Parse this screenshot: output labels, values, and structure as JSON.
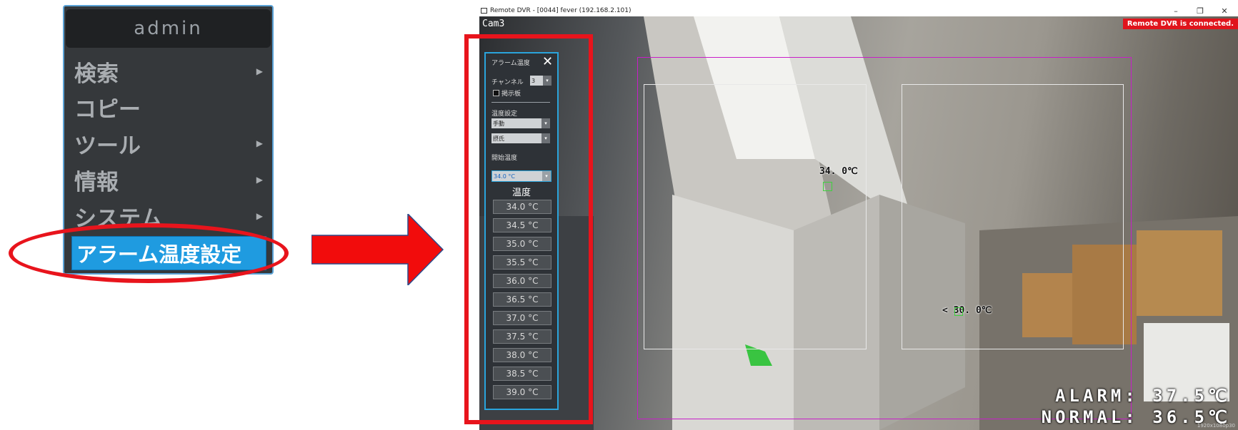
{
  "menu": {
    "title": "admin",
    "items": [
      {
        "label": "検索",
        "has_submenu": true
      },
      {
        "label": "コピー",
        "has_submenu": false
      },
      {
        "label": "ツール",
        "has_submenu": true
      },
      {
        "label": "情報",
        "has_submenu": true
      },
      {
        "label": "システム",
        "has_submenu": true
      }
    ],
    "selected_item": "アラーム温度設定",
    "selected_color": "#1f9be0"
  },
  "annotation": {
    "color": "#e8141c"
  },
  "window": {
    "title": "Remote DVR - [0044] fever (192.168.2.101)",
    "minimize": "–",
    "restore": "❐",
    "close": "✕"
  },
  "camera": {
    "label": "Cam3",
    "status": "Remote DVR is connected.",
    "resolution": "1920x1080p30",
    "alarm_readout": "ALARM: 37.5℃",
    "normal_readout": "NORMAL: 36.5℃",
    "tags": {
      "upper": "34. 0℃",
      "lower": "< 30. 0℃"
    }
  },
  "panel": {
    "title": "アラーム温度",
    "close": "✕",
    "channel_label": "チャンネル",
    "channel_value": "3",
    "board_label": "掲示板",
    "temp_setting_label": "温度設定",
    "mode_value": "手動",
    "unit_value": "摂氏",
    "start_temp_label": "開始温度",
    "start_temp_value": "34.0 °C",
    "dropdown_glyph": "▾",
    "temp_heading": "温度",
    "temps": [
      "34.0 °C",
      "34.5 °C",
      "35.0 °C",
      "35.5 °C",
      "36.0 °C",
      "36.5 °C",
      "37.0 °C",
      "37.5 °C",
      "38.0 °C",
      "38.5 °C",
      "39.0 °C"
    ]
  }
}
